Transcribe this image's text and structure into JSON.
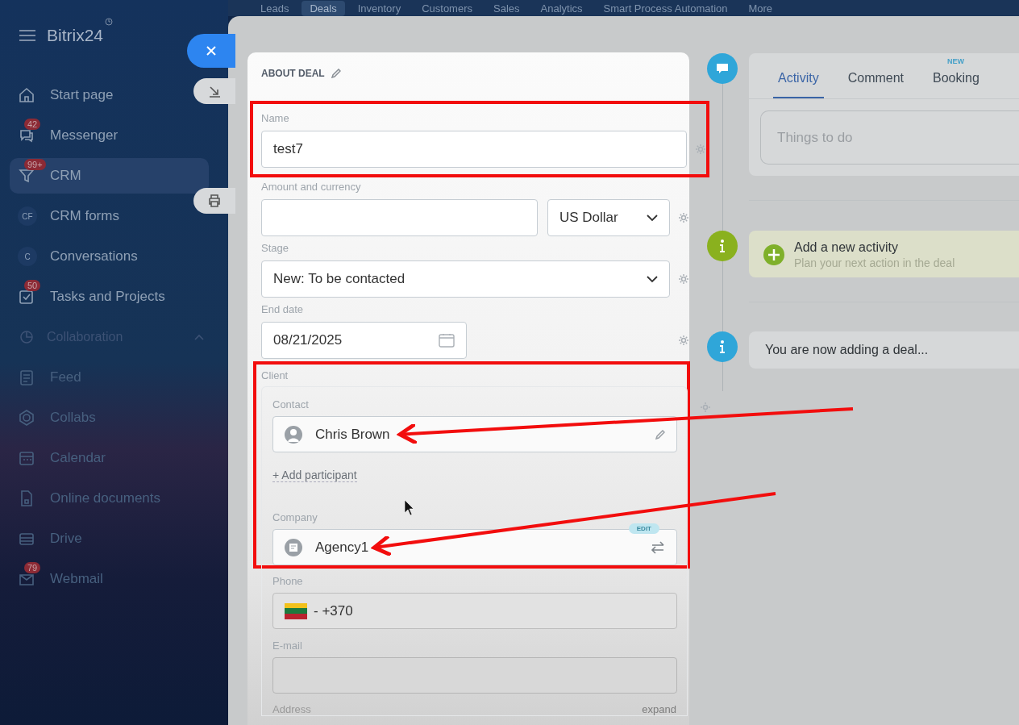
{
  "sidebar": {
    "logo": "Bitrix24",
    "items": [
      {
        "label": "Start page",
        "selected": false
      },
      {
        "label": "Messenger",
        "badge": "42",
        "selected": false
      },
      {
        "label": "CRM",
        "badge": "99+",
        "selected": true
      },
      {
        "label": "CRM forms",
        "mono": "CF",
        "selected": false
      },
      {
        "label": "Conversations",
        "mono": "C",
        "selected": false
      },
      {
        "label": "Tasks and Projects",
        "badge": "50",
        "selected": false
      }
    ],
    "section": {
      "label": "Collaboration",
      "expanded": true,
      "items": [
        {
          "label": "Feed",
          "selected": false
        },
        {
          "label": "Collabs",
          "selected": false
        },
        {
          "label": "Calendar",
          "selected": false
        },
        {
          "label": "Online documents",
          "selected": false
        },
        {
          "label": "Drive",
          "selected": false
        },
        {
          "label": "Webmail",
          "badge": "79",
          "selected": false
        }
      ]
    }
  },
  "top_nav": [
    {
      "label": "Leads",
      "selected": false
    },
    {
      "label": "Deals",
      "selected": true
    },
    {
      "label": "Inventory",
      "selected": false
    },
    {
      "label": "Customers",
      "selected": false
    },
    {
      "label": "Sales",
      "selected": false
    },
    {
      "label": "Analytics",
      "selected": false
    },
    {
      "label": "Smart Process Automation",
      "selected": false
    },
    {
      "label": "More",
      "selected": false
    }
  ],
  "deal_form": {
    "title": "ABOUT DEAL",
    "name": {
      "label": "Name",
      "value": "test7",
      "highlighted": true
    },
    "amount": {
      "label": "Amount and currency",
      "currency": "US Dollar"
    },
    "stage": {
      "label": "Stage",
      "value": "New: To be contacted"
    },
    "end_date": {
      "label": "End date",
      "value": "08/21/2025"
    },
    "client": {
      "label": "Client",
      "highlighted": true,
      "contact": {
        "label": "Contact",
        "value": "Chris Brown",
        "arrow": true
      },
      "add_link": "+ Add participant",
      "company": {
        "label": "Company",
        "value": "Agency1",
        "badge": "EDIT",
        "arrow": true
      },
      "phone": {
        "label": "Phone",
        "value": "- +370"
      },
      "email": {
        "label": "E-mail"
      },
      "address": {
        "label": "Address",
        "action": "expand"
      }
    }
  },
  "timeline": {
    "tabs": [
      {
        "label": "Activity",
        "selected": true
      },
      {
        "label": "Comment",
        "selected": false
      },
      {
        "label": "Booking",
        "badge": "NEW",
        "selected": false
      }
    ],
    "placeholder": "Things to do",
    "items": [
      {
        "kind": "action",
        "title": "Add a new activity",
        "subtitle": "Plan your next action in the deal"
      },
      {
        "kind": "info",
        "text": "You are now adding a deal..."
      }
    ]
  }
}
